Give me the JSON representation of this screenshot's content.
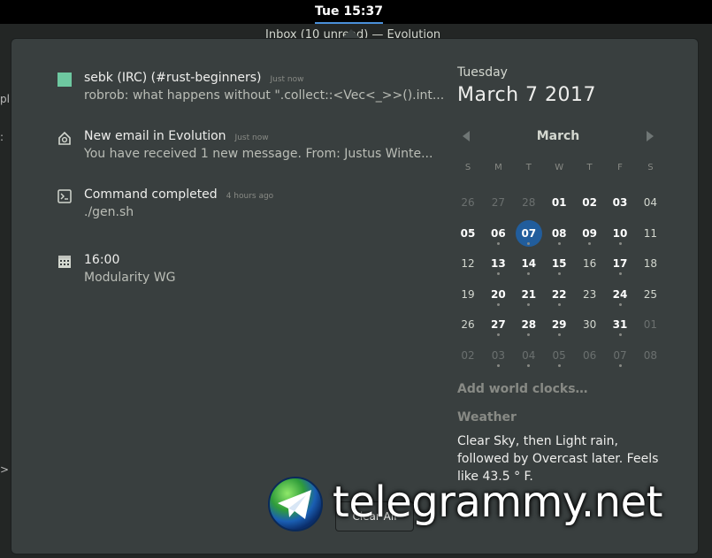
{
  "topbar": {
    "clock": "Tue 15:37"
  },
  "background_window": {
    "title_fragment": "Inbox (10 unread) — Evolution",
    "left_glyphs": [
      "pl",
      ":",
      ">"
    ]
  },
  "notifications": [
    {
      "icon": "chat-icon",
      "icon_color": "#6ec8a0",
      "title": "sebk (IRC) (#rust-beginners)",
      "time": "Just now",
      "body": "robrob: what happens without \".collect::<Vec<_>>().int..."
    },
    {
      "icon": "mail-icon",
      "title": "New email in Evolution",
      "time": "Just now",
      "body": "You have received 1 new message. From: Justus Winte..."
    },
    {
      "icon": "terminal-icon",
      "title": "Command completed",
      "time": "4 hours ago",
      "body": "./gen.sh"
    },
    {
      "icon": "calendar-icon",
      "title": "16:00",
      "time": "",
      "body": "Modularity WG"
    }
  ],
  "calendar": {
    "day_name": "Tuesday",
    "full_date": "March  7 2017",
    "month": "March",
    "weekdays": [
      "S",
      "M",
      "T",
      "W",
      "T",
      "F",
      "S"
    ],
    "weeks": [
      [
        {
          "d": "26",
          "t": "other"
        },
        {
          "d": "27",
          "t": "other"
        },
        {
          "d": "28",
          "t": "other"
        },
        {
          "d": "01",
          "t": "bold"
        },
        {
          "d": "02",
          "t": "bold"
        },
        {
          "d": "03",
          "t": "bold"
        },
        {
          "d": "04",
          "t": "cur"
        }
      ],
      [
        {
          "d": "05",
          "t": "bold"
        },
        {
          "d": "06",
          "t": "bold",
          "dot": true
        },
        {
          "d": "07",
          "t": "today",
          "dot": true
        },
        {
          "d": "08",
          "t": "bold",
          "dot": true
        },
        {
          "d": "09",
          "t": "bold",
          "dot": true
        },
        {
          "d": "10",
          "t": "bold",
          "dot": true
        },
        {
          "d": "11",
          "t": "cur"
        }
      ],
      [
        {
          "d": "12",
          "t": "cur"
        },
        {
          "d": "13",
          "t": "bold",
          "dot": true
        },
        {
          "d": "14",
          "t": "bold",
          "dot": true
        },
        {
          "d": "15",
          "t": "bold",
          "dot": true
        },
        {
          "d": "16",
          "t": "cur"
        },
        {
          "d": "17",
          "t": "bold",
          "dot": true
        },
        {
          "d": "18",
          "t": "cur"
        }
      ],
      [
        {
          "d": "19",
          "t": "cur"
        },
        {
          "d": "20",
          "t": "bold",
          "dot": true
        },
        {
          "d": "21",
          "t": "bold",
          "dot": true
        },
        {
          "d": "22",
          "t": "bold",
          "dot": true
        },
        {
          "d": "23",
          "t": "cur"
        },
        {
          "d": "24",
          "t": "bold",
          "dot": true
        },
        {
          "d": "25",
          "t": "cur"
        }
      ],
      [
        {
          "d": "26",
          "t": "cur"
        },
        {
          "d": "27",
          "t": "bold",
          "dot": true
        },
        {
          "d": "28",
          "t": "bold",
          "dot": true
        },
        {
          "d": "29",
          "t": "bold",
          "dot": true
        },
        {
          "d": "30",
          "t": "cur"
        },
        {
          "d": "31",
          "t": "bold",
          "dot": true
        },
        {
          "d": "01",
          "t": "other"
        }
      ],
      [
        {
          "d": "02",
          "t": "other"
        },
        {
          "d": "03",
          "t": "other",
          "dot": true
        },
        {
          "d": "04",
          "t": "other",
          "dot": true
        },
        {
          "d": "05",
          "t": "other",
          "dot": true
        },
        {
          "d": "06",
          "t": "other"
        },
        {
          "d": "07",
          "t": "other",
          "dot": true
        },
        {
          "d": "08",
          "t": "other"
        }
      ]
    ]
  },
  "world_clocks": "Add world clocks…",
  "weather": {
    "title": "Weather",
    "text": "Clear Sky, then Light rain, followed by Overcast later. Feels like 43.5 ° F."
  },
  "clear_button": "Clear All",
  "watermark": {
    "text": "telegrammy.net"
  },
  "colors": {
    "accent": "#4a90d9",
    "today": "#215d9c",
    "popover": "#393f3f"
  }
}
